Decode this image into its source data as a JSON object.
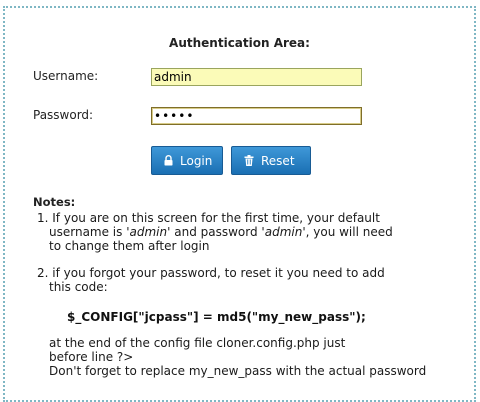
{
  "auth": {
    "title": "Authentication Area:",
    "username_label": "Username:",
    "username_value": "admin",
    "password_label": "Password:",
    "password_value": "admin",
    "login_label": "Login",
    "reset_label": "Reset"
  },
  "notes": {
    "heading": "Notes:",
    "item1_line1": "1. If you are on this screen for the first time, your default",
    "item1_line2_a": "username is '",
    "item1_line2_user": "admin",
    "item1_line2_b": "' and password '",
    "item1_line2_pass": "admin",
    "item1_line2_c": "', you will need",
    "item1_line3": "to change them after login",
    "item2_line1": "2. if you forgot your password, to reset it you need to add",
    "item2_line2": "this code:",
    "code": "$_CONFIG[\"jcpass\"] = md5(\"my_new_pass\");",
    "after_line1": "at the end of the config file cloner.config.php just",
    "after_line2": "before line ?>",
    "after_line3": "Don't forget to replace my_new_pass with the actual password"
  },
  "colors": {
    "button_bg": "#2a82c4",
    "username_bg": "#fbfbb8",
    "border_dotted": "#7fb7c4"
  },
  "icons": {
    "login": "lock-icon",
    "reset": "trash-icon"
  }
}
